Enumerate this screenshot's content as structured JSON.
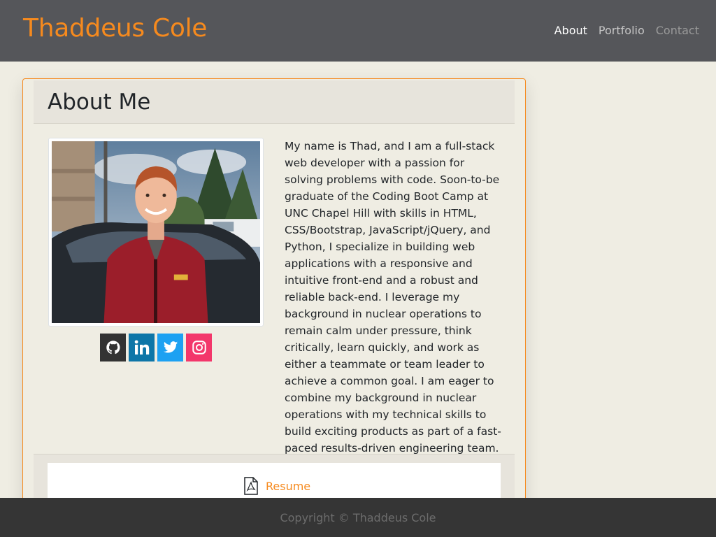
{
  "site": {
    "brand": "Thaddeus Cole"
  },
  "nav": {
    "items": [
      {
        "label": "About",
        "state": "active"
      },
      {
        "label": "Portfolio",
        "state": "normal"
      },
      {
        "label": "Contact",
        "state": "normal"
      }
    ]
  },
  "about": {
    "heading": "About Me",
    "bio": "My name is Thad, and I am a full-stack web developer with a passion for solving problems with code. Soon-to-be graduate of the Coding Boot Camp at UNC Chapel Hill with skills in HTML, CSS/Bootstrap, JavaScript/jQuery, and Python, I specialize in building web applications with a responsive and intuitive front-end and a robust and reliable back-end. I leverage my background in nuclear operations to remain calm under pressure, think critically, learn quickly, and work as either a teammate or team leader to achieve a common goal. I am eager to combine my background in nuclear operations with my technical skills to build exciting products as part of a fast-paced results-driven engineering team.",
    "photo": {
      "icon": "profile-photo"
    },
    "socials": [
      {
        "name": "GitHub",
        "icon": "github-icon",
        "color": "#333333"
      },
      {
        "name": "LinkedIn",
        "icon": "linkedin-icon",
        "color": "#0e76a8"
      },
      {
        "name": "Twitter",
        "icon": "twitter-icon",
        "color": "#1da1f2"
      },
      {
        "name": "Instagram",
        "icon": "instagram-icon",
        "color": "#f3376b"
      }
    ]
  },
  "resume": {
    "label": "Resume",
    "icon": "pdf-file-icon"
  },
  "footer": {
    "copyright": "Copyright © Thaddeus Cole"
  },
  "colors": {
    "accent": "#f68a1e",
    "navbar": "#55565a",
    "page_bg": "#efede3",
    "footer_bg": "#353535"
  }
}
